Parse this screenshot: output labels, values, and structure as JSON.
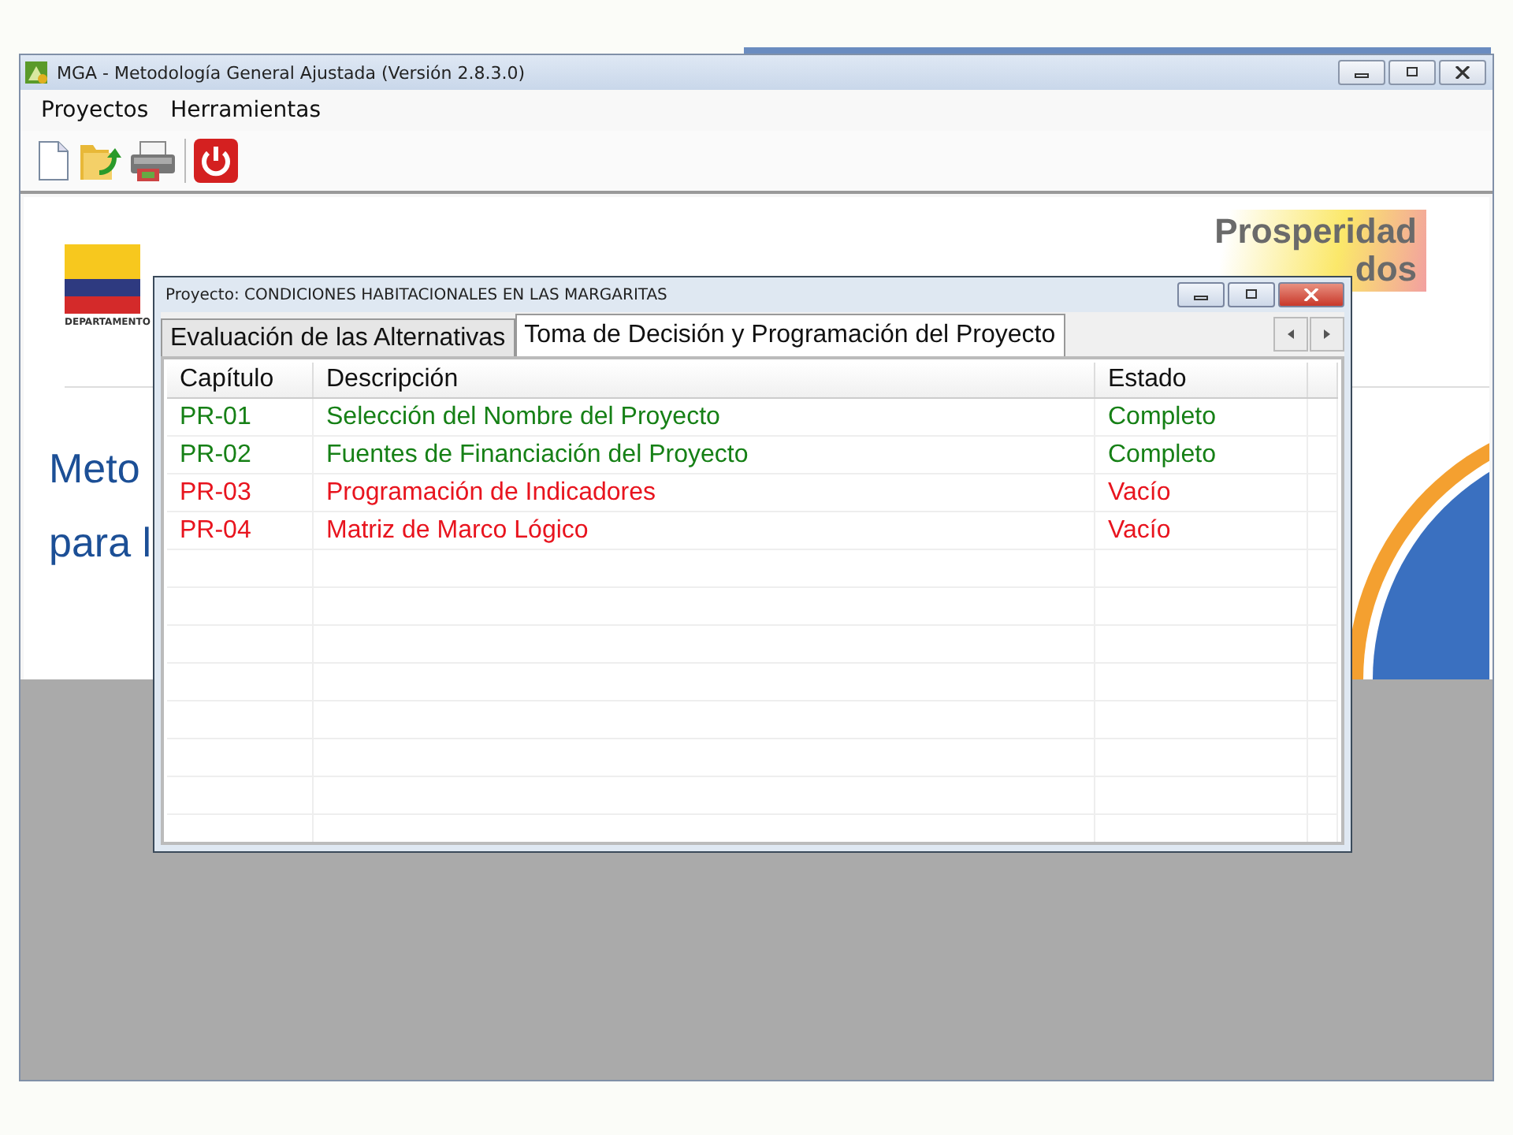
{
  "window": {
    "title": "MGA - Metodología General Ajustada (Versión 2.8.3.0)"
  },
  "menu": [
    "Proyectos",
    "Herramientas"
  ],
  "splash": {
    "department": "DEPARTAMENTO",
    "heading_lines": [
      "Meto",
      "para l"
    ],
    "slogan_lines": [
      "Prosperidad",
      "dos"
    ]
  },
  "dialog": {
    "title": "Proyecto: CONDICIONES HABITACIONALES EN LAS MARGARITAS",
    "tabs": [
      {
        "label": "Evaluación de las Alternativas",
        "selected": false
      },
      {
        "label": "Toma de Decisión y Programación del Proyecto",
        "selected": true
      }
    ],
    "table": {
      "columns": [
        "Capítulo",
        "Descripción",
        "Estado"
      ],
      "rows": [
        {
          "cells": [
            "PR-01",
            "Selección del Nombre del Proyecto",
            "Completo"
          ],
          "color": "#168016"
        },
        {
          "cells": [
            "PR-02",
            "Fuentes de Financiación del Proyecto",
            "Completo"
          ],
          "color": "#168016"
        },
        {
          "cells": [
            "PR-03",
            "Programación de Indicadores",
            "Vacío"
          ],
          "color": "#e8141e"
        },
        {
          "cells": [
            "PR-04",
            "Matriz de Marco Lógico",
            "Vacío"
          ],
          "color": "#e8141e"
        }
      ]
    }
  }
}
